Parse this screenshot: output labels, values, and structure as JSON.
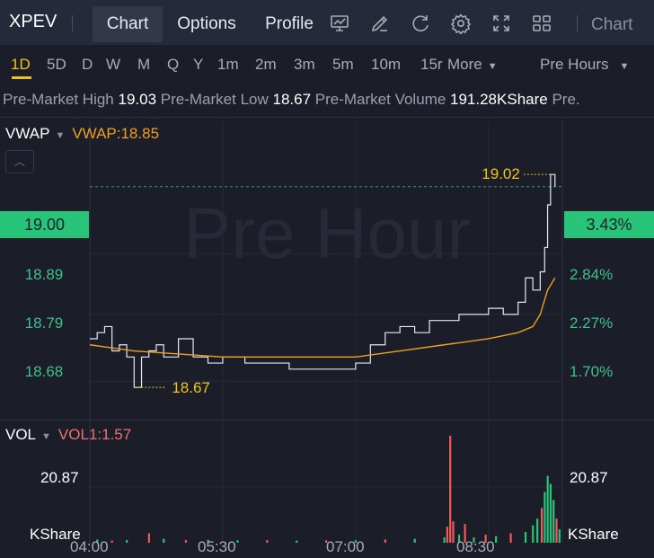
{
  "header": {
    "ticker": "XPEV",
    "tabs": [
      {
        "label": "Chart",
        "active": true
      },
      {
        "label": "Options",
        "active": false
      },
      {
        "label": "Profile",
        "active": false
      }
    ],
    "icons": [
      "chart-board-icon",
      "draw-pen-icon",
      "refresh-icon",
      "settings-gear-icon",
      "fullscreen-icon",
      "grid-layout-icon"
    ],
    "chart_type_label": "Chart"
  },
  "timeframes": {
    "items": [
      "1D",
      "5D",
      "D",
      "W",
      "M",
      "Q",
      "Y",
      "1m",
      "2m",
      "3m",
      "5m",
      "10m",
      "15r"
    ],
    "active": "1D",
    "more_label": "More",
    "session_label": "Pre Hours"
  },
  "premarket": {
    "high_label": "Pre-Market High",
    "high_value": "19.03",
    "low_label": "Pre-Market Low",
    "low_value": "18.67",
    "volume_label": "Pre-Market Volume",
    "volume_value": "191.28KShare",
    "overflow_text": "Pre."
  },
  "indicators": {
    "main_name": "VWAP",
    "main_value": "VWAP:18.85",
    "vol_name": "VOL",
    "vol_value": "VOL1:1.57"
  },
  "watermark": "Pre Hour",
  "colors": {
    "background": "#1b1e29",
    "up": "#28c47a",
    "down": "#f05a5a",
    "vwap": "#f0a020",
    "price_line": "#e6e8ee",
    "highlight": "#f0c419"
  },
  "chart_data": {
    "type": "line",
    "x_ticks": [
      "04:00",
      "05:30",
      "07:00",
      "08:30"
    ],
    "x_range": [
      "04:00",
      "09:20"
    ],
    "price_axis": {
      "left_ticks": [
        "18.89",
        "18.79",
        "18.68"
      ],
      "right_ticks": [
        "2.84%",
        "2.27%",
        "1.70%"
      ],
      "ylim": [
        18.62,
        19.1
      ],
      "current_price": "19.00",
      "current_change": "3.43%"
    },
    "annotations": {
      "high": "19.02",
      "low": "18.67"
    },
    "series": [
      {
        "name": "",
        "x": [
          "04:00",
          "04:05",
          "04:10",
          "04:15",
          "04:20",
          "04:25",
          "04:30",
          "04:35",
          "04:40",
          "04:45",
          "04:50",
          "05:00",
          "05:10",
          "05:20",
          "05:30",
          "05:45",
          "06:00",
          "06:15",
          "06:30",
          "06:45",
          "07:00",
          "07:10",
          "07:20",
          "07:30",
          "07:40",
          "07:50",
          "08:00",
          "08:10",
          "08:20",
          "08:30",
          "08:40",
          "08:50",
          "08:55",
          "09:00",
          "09:05",
          "09:08",
          "09:10",
          "09:12",
          "09:15"
        ],
        "values": [
          18.75,
          18.76,
          18.77,
          18.73,
          18.74,
          18.72,
          18.67,
          18.72,
          18.73,
          18.74,
          18.72,
          18.75,
          18.72,
          18.71,
          18.72,
          18.71,
          18.71,
          18.7,
          18.7,
          18.7,
          18.71,
          18.74,
          18.76,
          18.77,
          18.76,
          18.78,
          18.78,
          18.79,
          18.79,
          18.8,
          18.79,
          18.81,
          18.85,
          18.83,
          18.86,
          18.9,
          18.97,
          19.02,
          19.0
        ]
      },
      {
        "name": "VWAP",
        "x": [
          "04:00",
          "04:30",
          "05:00",
          "05:30",
          "06:00",
          "06:30",
          "07:00",
          "07:30",
          "08:00",
          "08:30",
          "08:50",
          "09:00",
          "09:05",
          "09:10",
          "09:15"
        ],
        "values": [
          18.74,
          18.73,
          18.725,
          18.72,
          18.72,
          18.72,
          18.72,
          18.73,
          18.74,
          18.75,
          18.76,
          18.77,
          18.79,
          18.83,
          18.85
        ]
      }
    ],
    "volume": {
      "axis_label": "20.87",
      "unit": "KShare",
      "ylim": [
        0,
        45
      ],
      "bars": [
        {
          "x": "04:05",
          "v": 1.2,
          "up": true
        },
        {
          "x": "04:15",
          "v": 0.8,
          "up": false
        },
        {
          "x": "04:25",
          "v": 1.0,
          "up": true
        },
        {
          "x": "04:40",
          "v": 3.5,
          "up": false
        },
        {
          "x": "04:50",
          "v": 1.5,
          "up": true
        },
        {
          "x": "05:05",
          "v": 1.0,
          "up": false
        },
        {
          "x": "05:20",
          "v": 1.1,
          "up": true
        },
        {
          "x": "05:40",
          "v": 0.9,
          "up": true
        },
        {
          "x": "06:00",
          "v": 1.0,
          "up": false
        },
        {
          "x": "06:20",
          "v": 0.8,
          "up": true
        },
        {
          "x": "06:40",
          "v": 0.9,
          "up": false
        },
        {
          "x": "07:00",
          "v": 1.0,
          "up": true
        },
        {
          "x": "07:20",
          "v": 1.2,
          "up": false
        },
        {
          "x": "07:40",
          "v": 1.5,
          "up": true
        },
        {
          "x": "08:00",
          "v": 2.0,
          "up": true
        },
        {
          "x": "08:02",
          "v": 6.0,
          "up": false
        },
        {
          "x": "08:04",
          "v": 40.0,
          "up": false
        },
        {
          "x": "08:06",
          "v": 8.0,
          "up": false
        },
        {
          "x": "08:10",
          "v": 3.0,
          "up": true
        },
        {
          "x": "08:14",
          "v": 7.0,
          "up": false
        },
        {
          "x": "08:20",
          "v": 2.0,
          "up": true
        },
        {
          "x": "08:28",
          "v": 3.0,
          "up": false
        },
        {
          "x": "08:35",
          "v": 2.5,
          "up": true
        },
        {
          "x": "08:45",
          "v": 3.5,
          "up": false
        },
        {
          "x": "08:55",
          "v": 4.0,
          "up": true
        },
        {
          "x": "09:00",
          "v": 6.5,
          "up": true
        },
        {
          "x": "09:03",
          "v": 9.0,
          "up": true
        },
        {
          "x": "09:06",
          "v": 13.0,
          "up": false
        },
        {
          "x": "09:08",
          "v": 19.0,
          "up": true
        },
        {
          "x": "09:10",
          "v": 25.0,
          "up": true
        },
        {
          "x": "09:12",
          "v": 22.0,
          "up": true
        },
        {
          "x": "09:14",
          "v": 16.0,
          "up": true
        },
        {
          "x": "09:16",
          "v": 9.0,
          "up": false
        },
        {
          "x": "09:18",
          "v": 5.0,
          "up": true
        }
      ]
    }
  }
}
